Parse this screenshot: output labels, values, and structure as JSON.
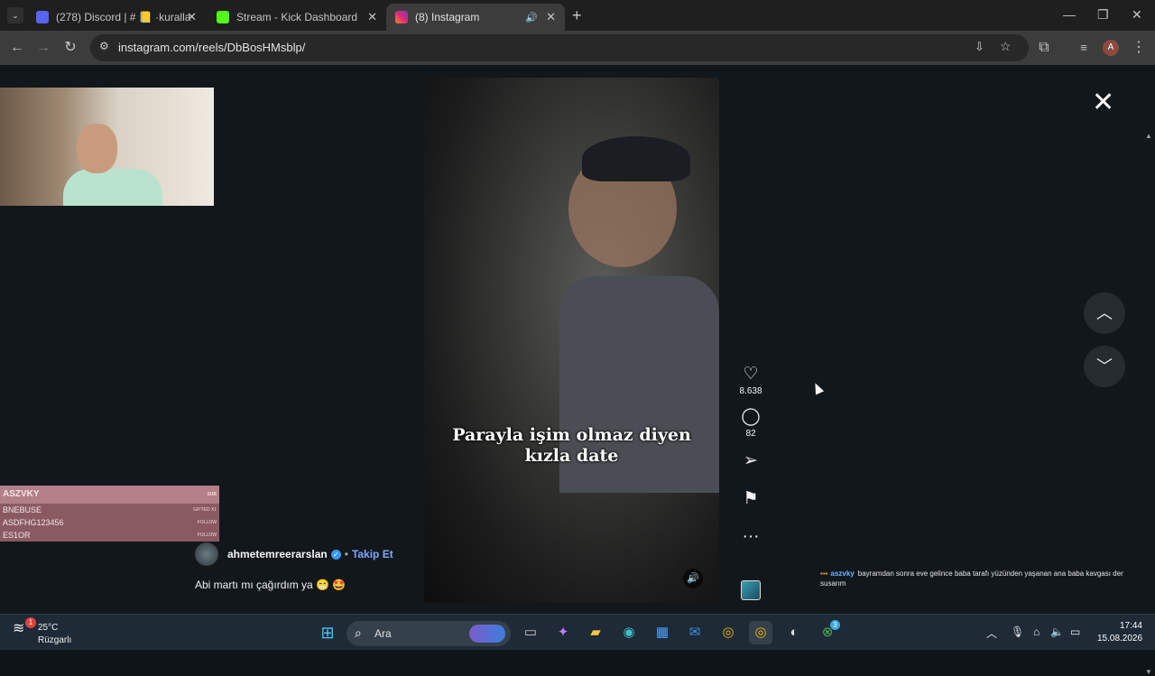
{
  "browser": {
    "tabs": [
      {
        "label": "(278) Discord | # 📒 ·kuralla",
        "favicon": "discord-icon",
        "color": "#5865f2"
      },
      {
        "label": "Stream - Kick Dashboard",
        "favicon": "kick-icon",
        "color": "#53fc18"
      },
      {
        "label": "(8) Instagram",
        "favicon": "instagram-icon",
        "color": "#e1306c",
        "active": true
      }
    ],
    "url": "instagram.com/reels/DbBosHMsblp/",
    "profile_initial": "A"
  },
  "reel": {
    "subtitle_line1": "Parayla işim olmaz diyen",
    "subtitle_line2": "kızla date",
    "likes": "8.638",
    "comments": "82",
    "author": "ahmetemreerarslan",
    "follow_label": "Takip Et",
    "caption": "Abi martı mı çağırdım ya 😁 🤩"
  },
  "overlay": {
    "alerts": [
      {
        "name": "ASZVKY",
        "tag": "SUB"
      },
      {
        "name": "BNEBUSE",
        "tag": "GIFTED X1"
      },
      {
        "name": "ASDFHG123456",
        "tag": "FOLLOW"
      },
      {
        "name": "ES1OR",
        "tag": "FOLLOW"
      }
    ],
    "chat": {
      "user": "aszvky",
      "message": "bayramdan sonra eve gelince baba tarafı yüzünden yaşanan ana baba kavgası der susarım"
    }
  },
  "taskbar": {
    "temperature": "25°C",
    "weather_label": "Rüzgarlı",
    "weather_badge": "1",
    "search_placeholder": "Ara",
    "time": "17:44",
    "date": "15.08.2026",
    "xbox_badge": "3"
  }
}
